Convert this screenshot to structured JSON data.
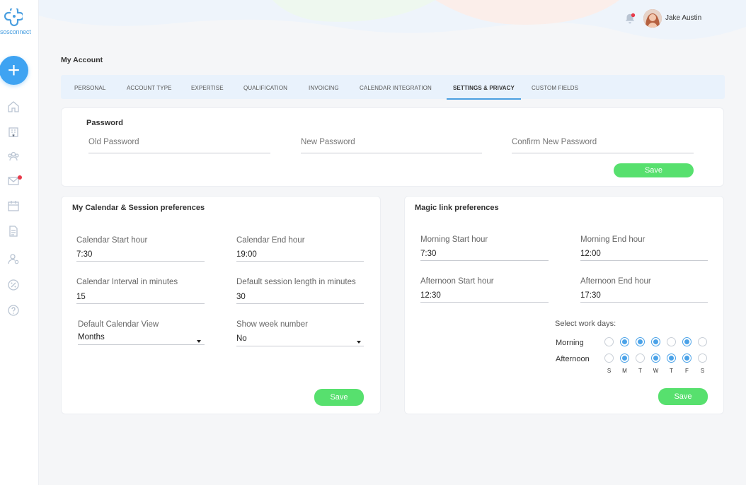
{
  "brand": {
    "logo_text": "sosconnect"
  },
  "user": {
    "name": "Jake Austin"
  },
  "page": {
    "title": "My Account"
  },
  "tabs": [
    {
      "label": "PERSONAL"
    },
    {
      "label": "ACCOUNT TYPE"
    },
    {
      "label": "EXPERTISE"
    },
    {
      "label": "QUALIFICATION"
    },
    {
      "label": "INVOICING"
    },
    {
      "label": "CALENDAR INTEGRATION"
    },
    {
      "label": "SETTINGS & PRIVACY",
      "active": true
    },
    {
      "label": "CUSTOM FIELDS"
    }
  ],
  "password": {
    "title": "Password",
    "old_placeholder": "Old Password",
    "new_placeholder": "New Password",
    "confirm_placeholder": "Confirm New Password",
    "save_label": "Save"
  },
  "calendar": {
    "title": "My Calendar & Session preferences",
    "start_label": "Calendar Start hour",
    "start_value": "7:30",
    "end_label": "Calendar End hour",
    "end_value": "19:00",
    "interval_label": "Calendar Interval in minutes",
    "interval_value": "15",
    "session_label": "Default session length in minutes",
    "session_value": "30",
    "view_label": "Default Calendar View",
    "view_value": "Months",
    "week_label": "Show week number",
    "week_value": "No",
    "save_label": "Save"
  },
  "magic": {
    "title": "Magic link preferences",
    "morning_start_label": "Morning Start hour",
    "morning_start_value": "7:30",
    "morning_end_label": "Morning End hour",
    "morning_end_value": "12:00",
    "afternoon_start_label": "Afternoon Start hour",
    "afternoon_start_value": "12:30",
    "afternoon_end_label": "Afternoon End hour",
    "afternoon_end_value": "17:30",
    "days_label": "Select work days:",
    "morning_label": "Morning",
    "afternoon_label": "Afternoon",
    "days": [
      "S",
      "M",
      "T",
      "W",
      "T",
      "F",
      "S"
    ],
    "morning_selected": [
      false,
      true,
      true,
      true,
      false,
      true,
      false
    ],
    "afternoon_selected": [
      false,
      true,
      false,
      true,
      true,
      true,
      false
    ],
    "save_label": "Save"
  },
  "colors": {
    "accent": "#3ea3f2",
    "save": "#57e06e",
    "notification": "#e83a4a"
  },
  "icons": [
    "home-icon",
    "building-icon",
    "users-icon",
    "mail-icon",
    "calendar-icon",
    "document-icon",
    "user-gear-icon",
    "percent-icon",
    "help-icon",
    "bell-icon"
  ]
}
